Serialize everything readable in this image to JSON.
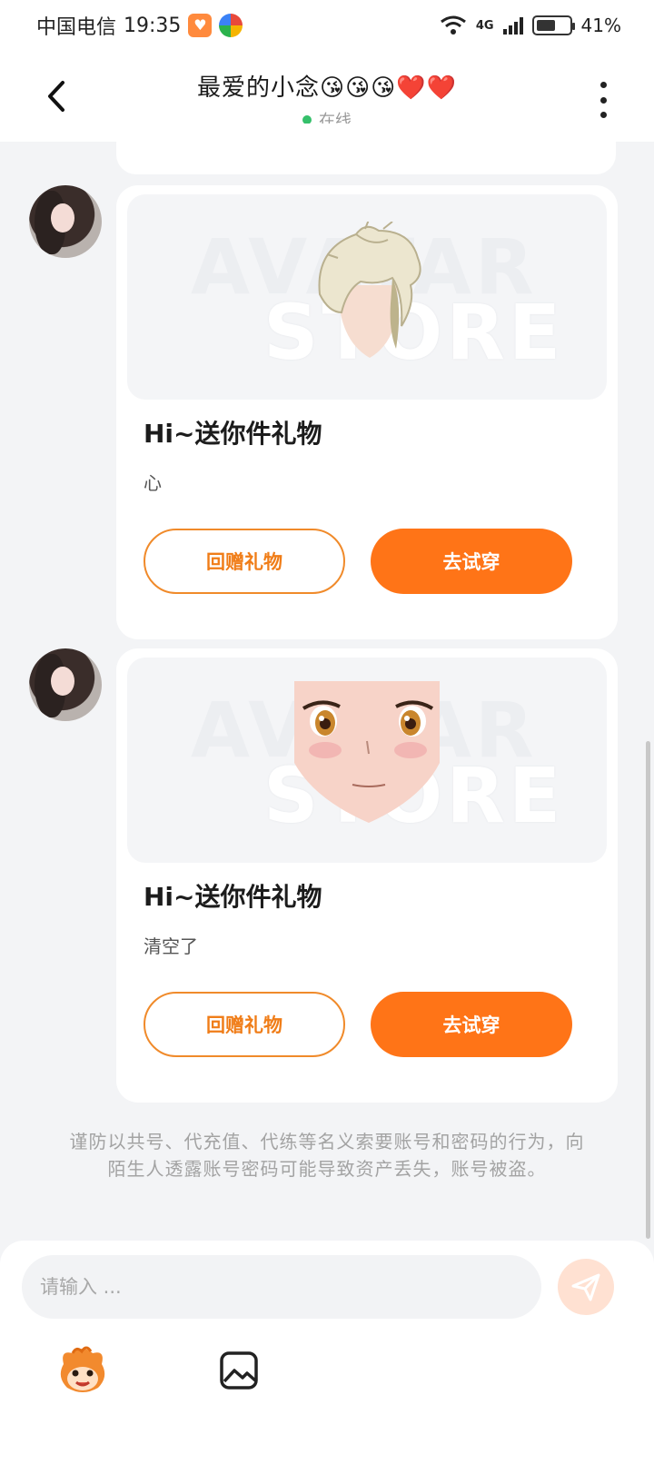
{
  "status_bar": {
    "carrier": "中国电信",
    "time": "19:35",
    "network": "4G",
    "battery": "41%"
  },
  "header": {
    "title": "最爱的小念😘😘😘❤️❤️",
    "status": "在线"
  },
  "messages": [
    {
      "title": "Hi~送你件礼物",
      "desc": "心",
      "watermark_top": "AVATAR",
      "watermark_bottom": "STORE",
      "return_gift_label": "回赠礼物",
      "try_on_label": "去试穿"
    },
    {
      "title": "Hi~送你件礼物",
      "desc": "清空了",
      "watermark_top": "AVATAR",
      "watermark_bottom": "STORE",
      "return_gift_label": "回赠礼物",
      "try_on_label": "去试穿"
    }
  ],
  "notice": "谨防以共号、代充值、代练等名义索要账号和密码的行为，向陌生人透露账号密码可能导致资产丢失，账号被盗。",
  "composer": {
    "placeholder": "请输入 ..."
  },
  "colors": {
    "accent": "#ff7417",
    "online": "#35c06b",
    "background": "#f3f4f6"
  },
  "icons": {
    "back": "chevron-left-icon",
    "more": "more-vertical-icon",
    "send": "send-icon",
    "emoji": "mascot-emoji-icon",
    "image": "image-icon"
  }
}
